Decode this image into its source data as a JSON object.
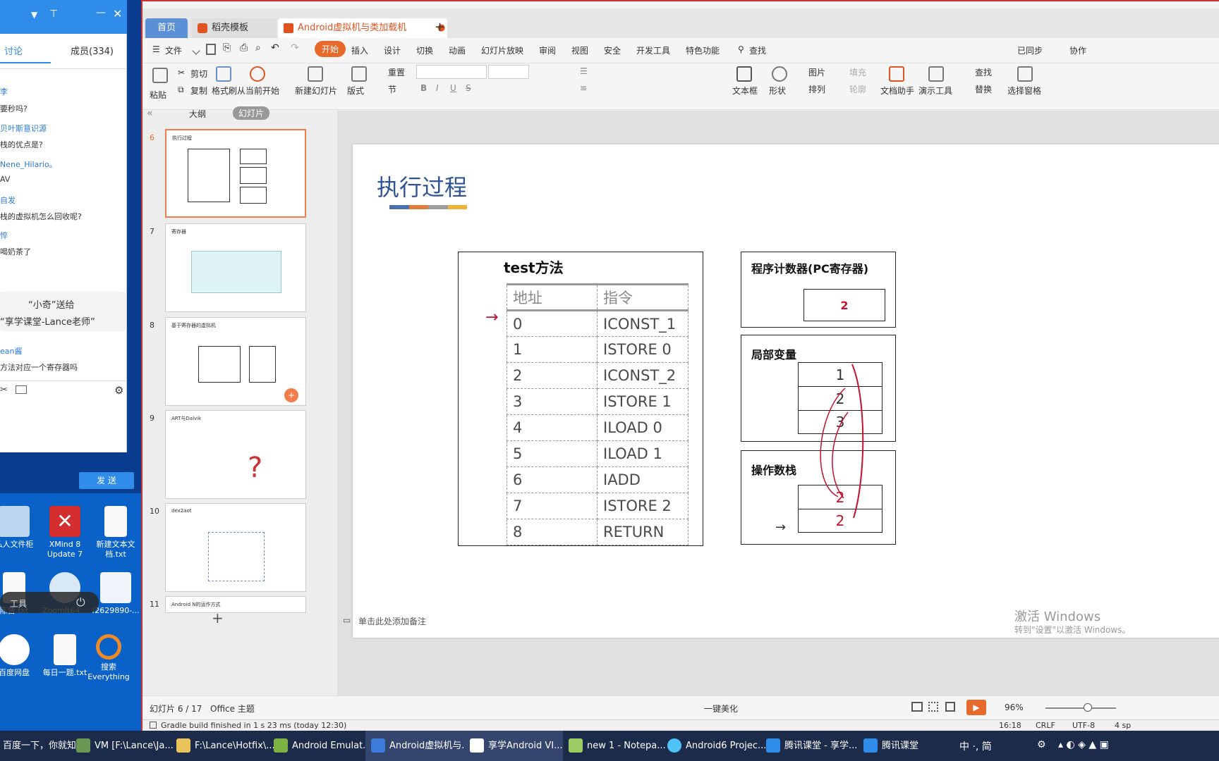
{
  "chat": {
    "tab_discuss": "讨论",
    "tab_members": "成员(334)",
    "messages": [
      {
        "name": "李",
        "text": "要秒吗?"
      },
      {
        "name": "贝叶斯意识源",
        "text": "栈的优点是?"
      },
      {
        "name": "Nene_Hilario。",
        "text": "AV"
      },
      {
        "name": "自发",
        "text": "栈的虚拟机怎么回收呢?"
      },
      {
        "name": "悴",
        "text": "喝奶茶了"
      }
    ],
    "gift_line1": "“小奇”送给",
    "gift_line2": "“享学课堂-Lance老师”",
    "msg_after_name": "ean酱",
    "msg_after_text": "方法对应一个寄存器吗",
    "send_label": "发 送"
  },
  "desktop": {
    "icons": [
      "私人文件柜",
      "XMind 8 Update 7",
      "新建文本文档.txt",
      "陈营.txt",
      "ZoomIt64...",
      "f2629890-...",
      "百度网盘",
      "每日一题.txt",
      "搜索Everything"
    ],
    "toolbar_label": "工具"
  },
  "wps": {
    "tabs": {
      "home": "首页",
      "template": "稻壳模板",
      "document": "Android虚拟机与类加载机制.pptx"
    },
    "menu": [
      "文件",
      "开始",
      "插入",
      "设计",
      "切换",
      "动画",
      "幻灯片放映",
      "审阅",
      "视图",
      "安全",
      "开发工具",
      "特色功能",
      "查找"
    ],
    "menu_right": [
      "已同步",
      "协作"
    ],
    "ribbon": {
      "paste": "粘贴",
      "cut": "剪切",
      "copy": "复制",
      "format_painter": "格式刷",
      "from_current": "从当前开始",
      "new_slide": "新建幻灯片",
      "layout": "版式",
      "reset": "重置",
      "section": "节",
      "textbox": "文本框",
      "shape": "形状",
      "picture": "图片",
      "fill": "填充",
      "arrange": "排列",
      "outline": "轮廓",
      "doc_assistant": "文档助手",
      "presentation_tools": "演示工具",
      "find": "查找",
      "replace": "替换",
      "select_pane": "选择窗格"
    },
    "panel_tabs": {
      "outline": "大纲",
      "slides": "幻灯片"
    },
    "thumbs": [
      {
        "num": "6",
        "title": "执行过程"
      },
      {
        "num": "7",
        "title": "寄存器"
      },
      {
        "num": "8",
        "title": "基于寄存器的虚拟机"
      },
      {
        "num": "9",
        "title": "ART与Dalvik"
      },
      {
        "num": "10",
        "title": "dex2aot"
      },
      {
        "num": "11",
        "title": "Android N的运作方式"
      }
    ],
    "notes_placeholder": "单击此处添加备注",
    "status": {
      "slide_count": "幻灯片 6 / 17",
      "theme": "Office 主题",
      "beautify": "一键美化",
      "zoom": "96%"
    },
    "gradle": "Gradle build finished in 1 s 23 ms (today 12:30)",
    "ide_status": {
      "pos": "16:18",
      "crlf": "CRLF",
      "enc": "UTF-8",
      "sp": "4 sp"
    },
    "activate_line1": "激活 Windows",
    "activate_line2": "转到\"设置\"以激活 Windows。"
  },
  "slide": {
    "title": "执行过程",
    "method_title": "test方法",
    "table_headers": [
      "地址",
      "指令"
    ],
    "rows": [
      [
        "0",
        "ICONST_1"
      ],
      [
        "1",
        "ISTORE 0"
      ],
      [
        "2",
        "ICONST_2"
      ],
      [
        "3",
        "ISTORE 1"
      ],
      [
        "4",
        "ILOAD 0"
      ],
      [
        "5",
        "ILOAD 1"
      ],
      [
        "6",
        "IADD"
      ],
      [
        "7",
        "ISTORE 2"
      ],
      [
        "8",
        "RETURN"
      ]
    ],
    "pc_title": "程序计数器(PC寄存器)",
    "pc_value": "2",
    "locals_title": "局部变量",
    "locals": [
      "1",
      "2",
      "3"
    ],
    "stack_title": "操作数栈",
    "stack": [
      "2",
      "2"
    ],
    "title_bar_colors": [
      "#4a6fb5",
      "#e07b39",
      "#9e9e9e",
      "#f2b233"
    ],
    "accent_red": "#c8102e"
  },
  "taskbar": {
    "items": [
      "百度一下，你就知...",
      "VM [F:\\Lance\\Ja...",
      "F:\\Lance\\Hotfix\\...",
      "Android Emulat...",
      "Android虚拟机与...",
      "享学Android VI...",
      "new 1 - Notepa...",
      "Android6 Projec...",
      "腾讯课堂 - 享学...",
      "腾讯课堂"
    ],
    "tray_text": "中 ·, 简"
  }
}
